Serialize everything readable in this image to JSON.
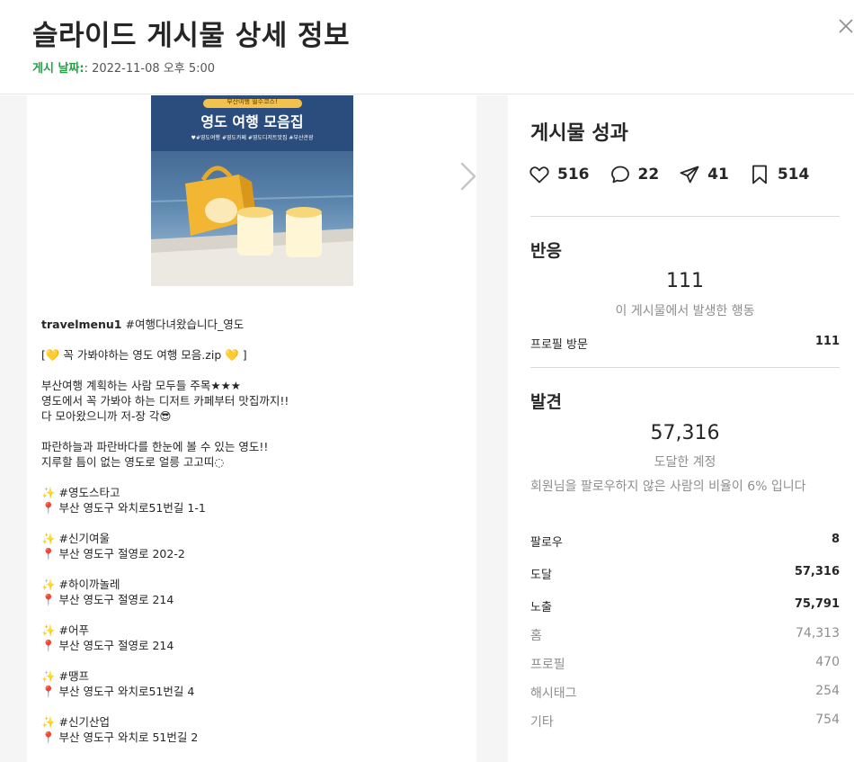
{
  "header": {
    "title": "슬라이드 게시물 상세 정보",
    "date_label": "게시 날짜:",
    "date_value": ": 2022-11-08 오후 5:00"
  },
  "post": {
    "image": {
      "banner_top": "부산여행 필수코스!",
      "banner_title": "영도 여행 모음집",
      "hashtags": "♥#영도여행 #영도카페 #영도디저트맛집 #부산관광"
    },
    "caption": [
      {
        "user": "travelmenu1",
        "text": "#여행다녀왔습니다_영도"
      },
      {
        "lines": [
          "[💛 꼭 가봐야하는 영도 여행 모음.zip 💛 ]"
        ]
      },
      {
        "lines": [
          "부산여행 계획하는 사람 모두들 주목★★★",
          "영도에서 꼭 가봐야 하는 디저트 카페부터 맛집까지!!",
          "다 모아왔으니까 저-장 각😎"
        ]
      },
      {
        "lines": [
          "파란하늘과 파란바다를 한눈에 볼 수 있는 영도!!",
          "지루할 틈이 없는 영도로 얼릉 고고띠◌"
        ]
      },
      {
        "lines": [
          "✨ #영도스타고",
          "📍 부산 영도구 와치로51번길 1-1"
        ]
      },
      {
        "lines": [
          "✨ #신기여울",
          "📍 부산 영도구 절영로 202-2"
        ]
      },
      {
        "lines": [
          "✨ #하이까놀레",
          "📍 부산 영도구 절영로 214"
        ]
      },
      {
        "lines": [
          "✨ #어푸",
          "📍 부산 영도구 절영로 214"
        ]
      },
      {
        "lines": [
          "✨ #땡프",
          "📍 부산 영도구 와치로51번길 4"
        ]
      },
      {
        "lines": [
          "✨ #신기산업",
          "📍 부산 영도구 와치로 51번길 2"
        ]
      }
    ]
  },
  "performance": {
    "title": "게시물 성과",
    "likes": "516",
    "comments": "22",
    "shares": "41",
    "saves": "514"
  },
  "reaction": {
    "title": "반응",
    "count": "111",
    "desc": "이 게시물에서 발생한 행동",
    "rows": [
      {
        "label": "프로필 방문",
        "value": "111"
      }
    ]
  },
  "discovery": {
    "title": "발견",
    "count": "57,316",
    "desc": "도달한 계정",
    "note": "회원님을 팔로우하지 않은 사람의 비율이 6% 입니다",
    "rows": [
      {
        "label": "팔로우",
        "value": "8"
      },
      {
        "label": "도달",
        "value": "57,316"
      },
      {
        "label": "노출",
        "value": "75,791"
      }
    ],
    "breakdown": [
      {
        "label": "홈",
        "value": "74,313"
      },
      {
        "label": "프로필",
        "value": "470"
      },
      {
        "label": "해시태그",
        "value": "254"
      },
      {
        "label": "기타",
        "value": "754"
      }
    ]
  },
  "colors": {
    "accent_green": "#22a244",
    "muted": "#8e8e8e",
    "text": "#262626",
    "panel_bg": "#f5f5f5"
  }
}
